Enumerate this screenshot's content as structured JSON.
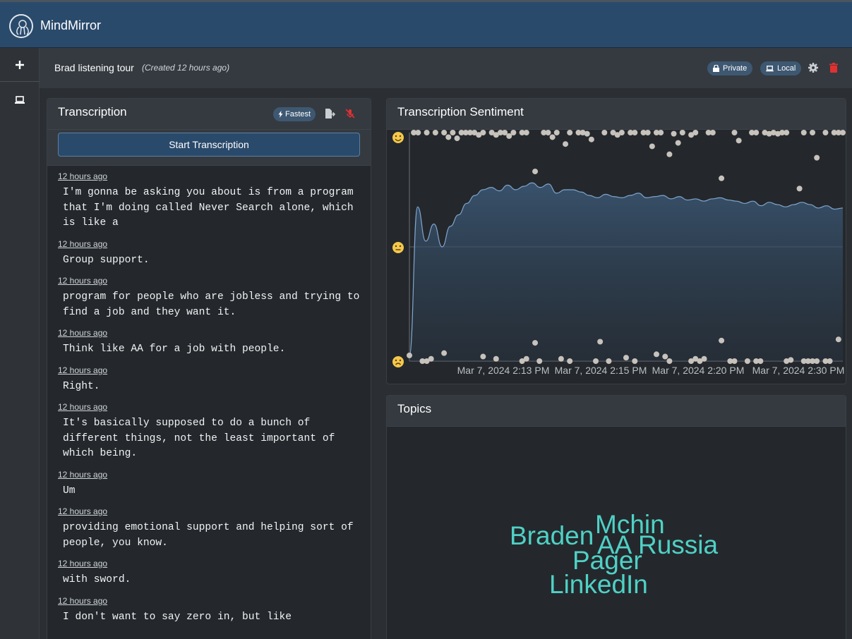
{
  "app": {
    "title": "MindMirror"
  },
  "rail": {
    "add_icon": "plus-icon",
    "local_icon": "laptop-icon"
  },
  "session": {
    "name": "Brad listening tour",
    "created": "(Created 12 hours ago)",
    "private_label": "Private",
    "local_label": "Local",
    "icons": [
      "lock-icon",
      "laptop-icon",
      "gear-icon",
      "trash-icon"
    ],
    "trash_color": "#e03131"
  },
  "transcription": {
    "title": "Transcription",
    "speed_label": "Fastest",
    "start_button": "Start Transcription",
    "entries": [
      {
        "time": "12 hours ago",
        "text": "I'm gonna be asking you about is from a program that I'm doing called Never Search alone, which is like a"
      },
      {
        "time": "12 hours ago",
        "text": "Group support."
      },
      {
        "time": "12 hours ago",
        "text": "program for people who are jobless and trying to find a job and they want it."
      },
      {
        "time": "12 hours ago",
        "text": "Think like AA for a job with people."
      },
      {
        "time": "12 hours ago",
        "text": "Right."
      },
      {
        "time": "12 hours ago",
        "text": "It's basically supposed to do a bunch of different things, not the least important of which being."
      },
      {
        "time": "12 hours ago",
        "text": "Um"
      },
      {
        "time": "12 hours ago",
        "text": "providing emotional support and helping sort of people, you know."
      },
      {
        "time": "12 hours ago",
        "text": "with sword."
      },
      {
        "time": "12 hours ago",
        "text": "I don't want to say zero in, but like"
      }
    ]
  },
  "sentiment": {
    "title": "Transcription Sentiment",
    "icons": [
      "happy-face-icon",
      "neutral-face-icon",
      "sad-face-icon"
    ],
    "chart_data": {
      "type": "line",
      "x_ticks": [
        "Mar 7, 2024 2:13 PM",
        "Mar 7, 2024 2:15 PM",
        "Mar 7, 2024 2:20 PM",
        "Mar 7, 2024 2:30 PM"
      ],
      "ylim": [
        -1,
        1
      ],
      "line_color": "#7fa6cf",
      "point_color": "#c7c2bc",
      "line": [
        -0.95,
        0.35,
        0.05,
        0.2,
        0.0,
        0.18,
        0.28,
        0.38,
        0.45,
        0.5,
        0.52,
        0.49,
        0.54,
        0.5,
        0.53,
        0.56,
        0.52,
        0.55,
        0.47,
        0.5,
        0.5,
        0.48,
        0.45,
        0.43,
        0.46,
        0.44,
        0.43,
        0.45,
        0.47,
        0.43,
        0.44,
        0.45,
        0.42,
        0.44,
        0.41,
        0.42,
        0.4,
        0.42,
        0.43,
        0.41,
        0.4,
        0.38,
        0.4,
        0.36,
        0.39,
        0.37,
        0.35,
        0.37,
        0.39,
        0.37,
        0.34,
        0.36,
        0.33,
        0.34
      ],
      "points": [
        [
          0.01,
          1
        ],
        [
          0.02,
          1
        ],
        [
          0.04,
          1
        ],
        [
          0.06,
          1
        ],
        [
          0.08,
          1
        ],
        [
          0.09,
          0.96
        ],
        [
          0.1,
          1
        ],
        [
          0.11,
          0.95
        ],
        [
          0.12,
          1
        ],
        [
          0.13,
          1
        ],
        [
          0.14,
          1
        ],
        [
          0.15,
          1
        ],
        [
          0.16,
          0.98
        ],
        [
          0.17,
          1
        ],
        [
          0.19,
          1
        ],
        [
          0.2,
          0.98
        ],
        [
          0.21,
          1
        ],
        [
          0.22,
          1
        ],
        [
          0.23,
          0.97
        ],
        [
          0.24,
          1
        ],
        [
          0.26,
          1
        ],
        [
          0.27,
          1
        ],
        [
          0.29,
          0.66
        ],
        [
          0.31,
          1
        ],
        [
          0.32,
          1
        ],
        [
          0.33,
          0.96
        ],
        [
          0.34,
          1
        ],
        [
          0.36,
          0.9
        ],
        [
          0.37,
          1
        ],
        [
          0.39,
          1
        ],
        [
          0.4,
          1
        ],
        [
          0.41,
          0.99
        ],
        [
          0.42,
          0.94
        ],
        [
          0.45,
          1
        ],
        [
          0.47,
          1
        ],
        [
          0.48,
          0.98
        ],
        [
          0.49,
          1
        ],
        [
          0.51,
          1
        ],
        [
          0.52,
          1
        ],
        [
          0.54,
          1
        ],
        [
          0.55,
          1
        ],
        [
          0.56,
          0.88
        ],
        [
          0.57,
          1
        ],
        [
          0.58,
          1
        ],
        [
          0.6,
          0.81
        ],
        [
          0.61,
          0.99
        ],
        [
          0.62,
          0.91
        ],
        [
          0.63,
          1
        ],
        [
          0.65,
          0.98
        ],
        [
          0.66,
          1
        ],
        [
          0.69,
          1
        ],
        [
          0.7,
          1
        ],
        [
          0.72,
          0.6
        ],
        [
          0.75,
          1
        ],
        [
          0.76,
          0.93
        ],
        [
          0.79,
          1
        ],
        [
          0.8,
          1
        ],
        [
          0.82,
          1
        ],
        [
          0.83,
          0.99
        ],
        [
          0.84,
          1
        ],
        [
          0.85,
          0.99
        ],
        [
          0.86,
          1
        ],
        [
          0.87,
          1
        ],
        [
          0.9,
          0.51
        ],
        [
          0.91,
          1
        ],
        [
          0.93,
          1
        ],
        [
          0.94,
          0.78
        ],
        [
          0.96,
          1
        ],
        [
          0.98,
          1
        ],
        [
          0.99,
          1
        ],
        [
          1.0,
          1
        ],
        [
          0.0,
          -0.95
        ],
        [
          0.03,
          -1
        ],
        [
          0.04,
          -1
        ],
        [
          0.05,
          -0.98
        ],
        [
          0.08,
          -0.93
        ],
        [
          0.17,
          -0.96
        ],
        [
          0.2,
          -0.98
        ],
        [
          0.26,
          -1
        ],
        [
          0.27,
          -0.98
        ],
        [
          0.29,
          -0.84
        ],
        [
          0.3,
          -1
        ],
        [
          0.35,
          -0.98
        ],
        [
          0.37,
          -1
        ],
        [
          0.43,
          -1
        ],
        [
          0.44,
          -0.83
        ],
        [
          0.46,
          -1
        ],
        [
          0.5,
          -0.97
        ],
        [
          0.52,
          -1
        ],
        [
          0.57,
          -0.94
        ],
        [
          0.59,
          -0.96
        ],
        [
          0.6,
          -1
        ],
        [
          0.65,
          -1
        ],
        [
          0.66,
          -0.98
        ],
        [
          0.67,
          -1
        ],
        [
          0.68,
          -0.98
        ],
        [
          0.72,
          -0.82
        ],
        [
          0.74,
          -1
        ],
        [
          0.75,
          -1
        ],
        [
          0.78,
          -1
        ],
        [
          0.8,
          -1
        ],
        [
          0.81,
          -1
        ],
        [
          0.87,
          -1
        ],
        [
          0.88,
          -0.99
        ],
        [
          0.91,
          -1
        ],
        [
          0.92,
          -1
        ],
        [
          0.93,
          -1
        ],
        [
          0.94,
          -1
        ],
        [
          0.96,
          -1
        ],
        [
          0.97,
          -1
        ],
        [
          0.99,
          -0.81
        ]
      ]
    }
  },
  "topics": {
    "title": "Topics",
    "color": "#4fd1c5",
    "words": [
      "Mchin",
      "Braden",
      "AA",
      "Russia",
      "Pager",
      "LinkedIn"
    ]
  }
}
